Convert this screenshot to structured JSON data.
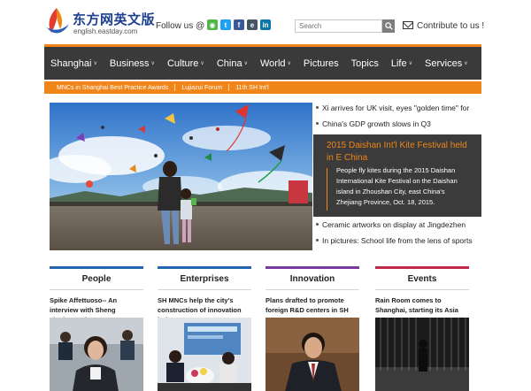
{
  "header": {
    "logo_cn": "东方网英文版",
    "logo_en": "english.eastday.com",
    "follow_label": "Follow us @",
    "search_placeholder": "Search",
    "contribute_label": "Contribute to us !"
  },
  "nav": {
    "items": [
      {
        "label": "Shanghai",
        "caret": "∨"
      },
      {
        "label": "Business",
        "caret": "∨"
      },
      {
        "label": "Culture",
        "caret": "∨"
      },
      {
        "label": "China",
        "caret": "∨"
      },
      {
        "label": "World",
        "caret": "∨"
      },
      {
        "label": "Pictures",
        "caret": ""
      },
      {
        "label": "Topics",
        "caret": ""
      },
      {
        "label": "Life",
        "caret": "∨"
      },
      {
        "label": "Services",
        "caret": "∨"
      }
    ]
  },
  "subbar": {
    "items": [
      "MNCs in Shanghai Best Practice Awards",
      "Lujiazui Forum",
      "11th SH Int'l"
    ]
  },
  "headlines": {
    "top": [
      "Xi arrives for UK visit, eyes \"golden time\" for",
      "China's GDP growth slows in Q3"
    ],
    "bottom": [
      "Ceramic artworks on display at Jingdezhen",
      "In pictures: School life from the lens of sports"
    ]
  },
  "feature": {
    "title": "2015 Daishan Int'l Kite Festival held in E China",
    "desc": "People fly kites during the 2015 Daishan International Kite Festival on the Daishan island in Zhoushan City, east China's Zhejiang Province, Oct. 18, 2015."
  },
  "columns": [
    {
      "title": "People",
      "text": "Spike Affettuoso-- An interview with Sheng Jianhong, the",
      "color": "#2266b0"
    },
    {
      "title": "Enterprises",
      "text": "SH MNCs help the city's construction of innovation hub",
      "color": "#2266b0"
    },
    {
      "title": "Innovation",
      "text": "Plans drafted to promote foreign R&D centers in SH",
      "color": "#7b3aa0"
    },
    {
      "title": "Events",
      "text": "Rain Room comes to Shanghai, starting its Asia tours",
      "color": "#c0294d"
    }
  ],
  "colors": {
    "accent": "#f08519",
    "nav_bg": "#3a3a3a"
  }
}
